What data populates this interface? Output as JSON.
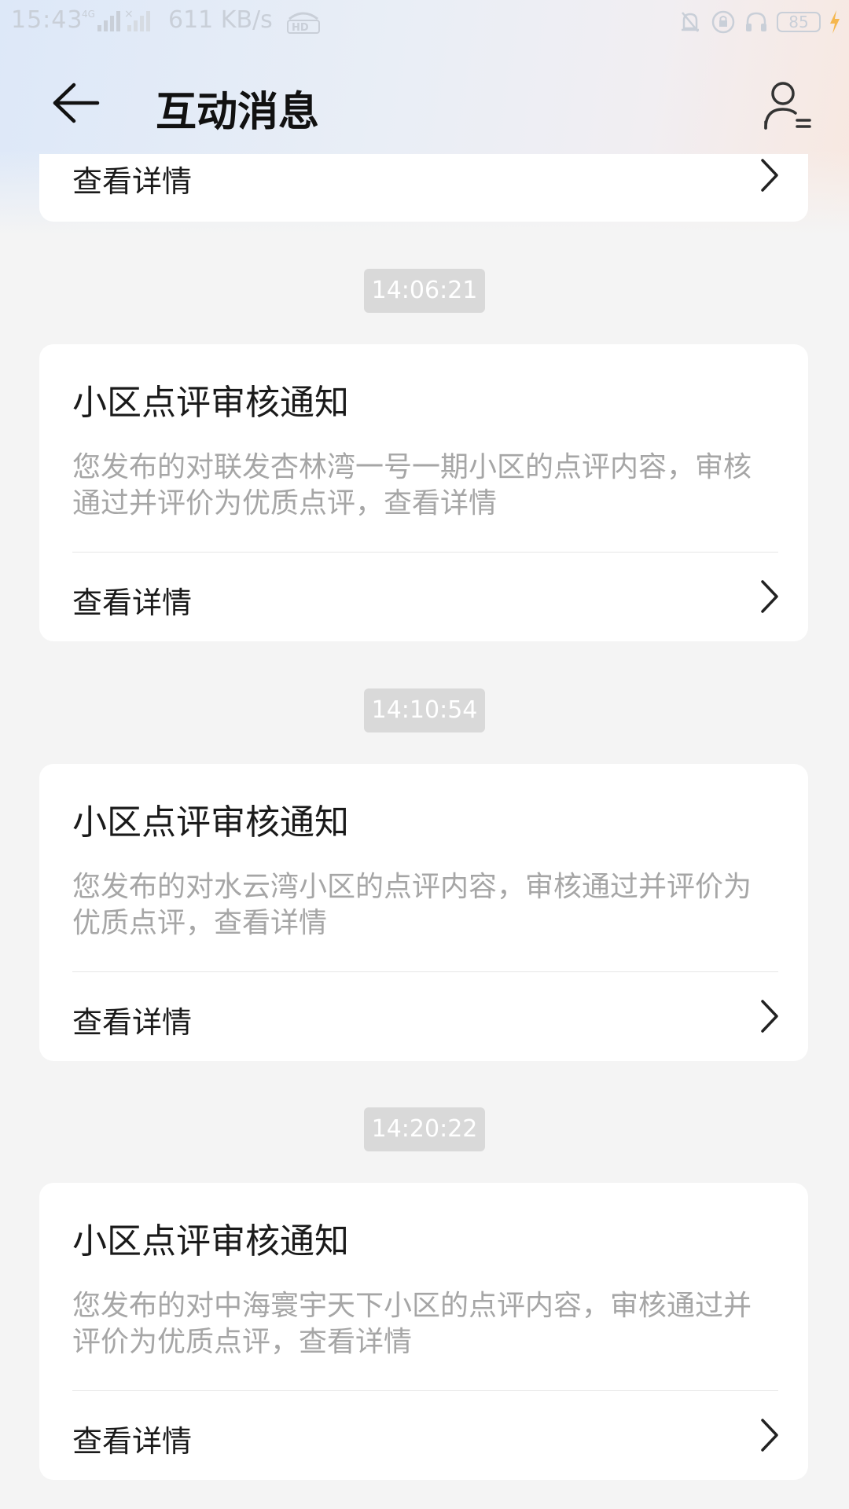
{
  "status_bar": {
    "time": "15:43",
    "network_speed": "611 KB/s",
    "battery_level": "85",
    "icons": [
      "4g-signal-icon",
      "hd-icon",
      "bell-muted-icon",
      "lock-rotation-icon",
      "headphones-icon",
      "battery-icon",
      "charging-icon"
    ]
  },
  "header": {
    "title": "互动消息",
    "back_icon": "arrow-left-icon",
    "user_icon": "user-settings-icon"
  },
  "messages": [
    {
      "time": "",
      "title": "",
      "body": "",
      "action_label": "查看详情"
    },
    {
      "time": "14:06:21",
      "title": "小区点评审核通知",
      "body": "您发布的对联发杏林湾一号一期小区的点评内容，审核通过并评价为优质点评，查看详情",
      "action_label": "查看详情"
    },
    {
      "time": "14:10:54",
      "title": "小区点评审核通知",
      "body": "您发布的对水云湾小区的点评内容，审核通过并评价为优质点评，查看详情",
      "action_label": "查看详情"
    },
    {
      "time": "14:20:22",
      "title": "小区点评审核通知",
      "body": "您发布的对中海寰宇天下小区的点评内容，审核通过并评价为优质点评，查看详情",
      "action_label": "查看详情"
    }
  ],
  "colors": {
    "background": "#f4f4f4",
    "card": "#ffffff",
    "title_text": "#1a1a1a",
    "body_text": "#a6a6a6",
    "time_badge": "#d9d9d9"
  }
}
